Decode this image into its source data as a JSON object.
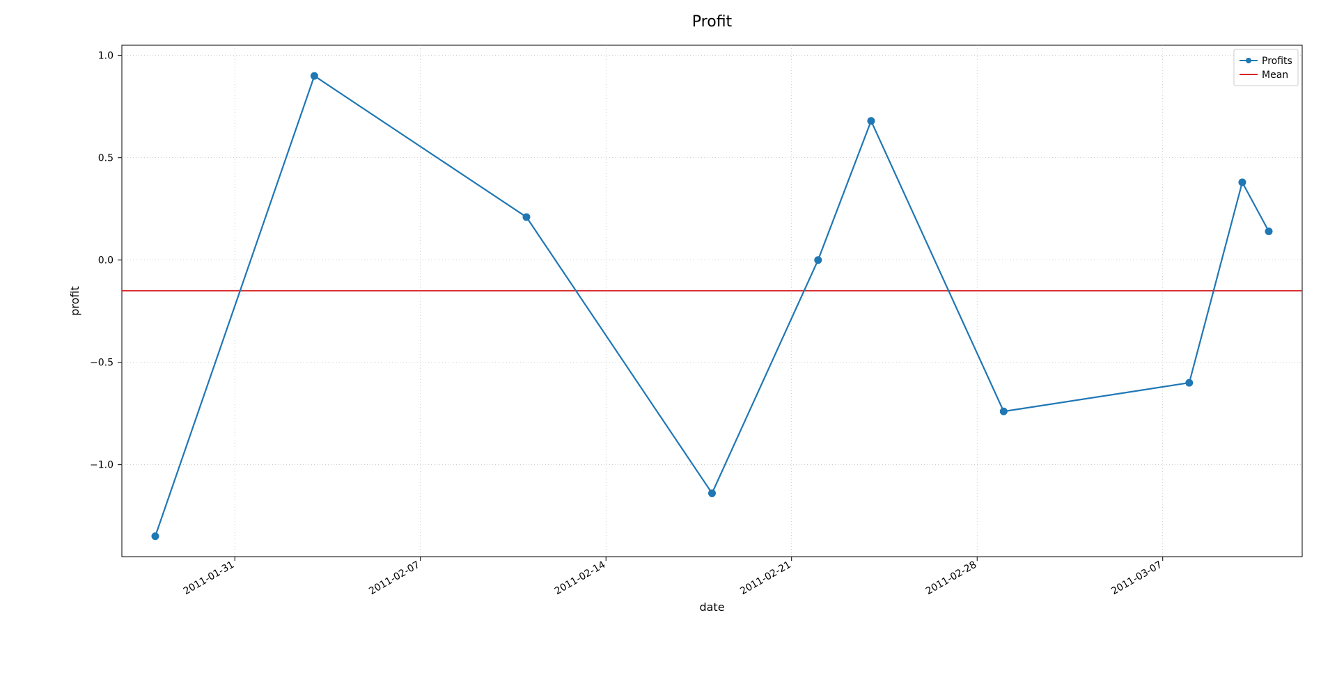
{
  "chart_data": {
    "type": "line",
    "title": "Profit",
    "xlabel": "date",
    "ylabel": "profit",
    "x_dates": [
      "2011-01-28",
      "2011-02-03",
      "2011-02-11",
      "2011-02-18",
      "2011-02-22",
      "2011-02-24",
      "2011-03-01",
      "2011-03-08",
      "2011-03-10",
      "2011-03-11"
    ],
    "series": [
      {
        "name": "Profits",
        "color": "#1f77b4",
        "marker": "o",
        "values": [
          -1.35,
          0.9,
          0.21,
          -1.14,
          0.0,
          0.68,
          -0.74,
          -0.6,
          0.38,
          0.14
        ]
      },
      {
        "name": "Mean",
        "color": "#d62728",
        "style": "hline",
        "value": -0.15
      }
    ],
    "x_ticks": [
      "2011-01-31",
      "2011-02-07",
      "2011-02-14",
      "2011-02-21",
      "2011-02-28",
      "2011-03-07"
    ],
    "y_ticks": [
      -1.0,
      -0.5,
      0.0,
      0.5,
      1.0
    ],
    "ylim": [
      -1.45,
      1.05
    ],
    "legend_position": "upper-right",
    "grid": true
  }
}
